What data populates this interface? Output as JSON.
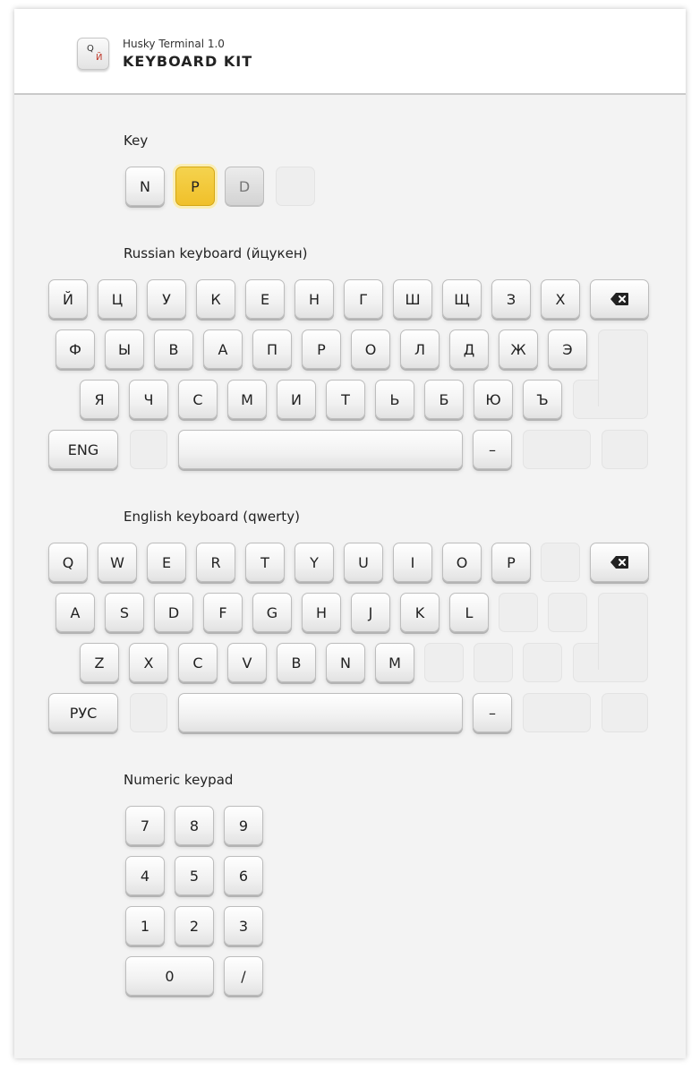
{
  "header": {
    "app_subtitle": "Husky Terminal 1.0",
    "app_title": "KEYBOARD KIT",
    "logo_top_glyph": "Q",
    "logo_bottom_glyph": "Й"
  },
  "sections": {
    "key_states": "Key",
    "russian": "Russian keyboard (йцукен)",
    "english": "English keyboard (qwerty)",
    "numeric": "Numeric keypad"
  },
  "key_states": {
    "normal": "N",
    "pressed": "P",
    "disabled": "D"
  },
  "russian": {
    "row1": [
      "Й",
      "Ц",
      "У",
      "К",
      "Е",
      "Н",
      "Г",
      "Ш",
      "Щ",
      "З",
      "Х"
    ],
    "row2": [
      "Ф",
      "Ы",
      "В",
      "А",
      "П",
      "Р",
      "О",
      "Л",
      "Д",
      "Ж",
      "Э"
    ],
    "row3": [
      "Я",
      "Ч",
      "С",
      "М",
      "И",
      "Т",
      "Ь",
      "Б",
      "Ю",
      "Ъ"
    ],
    "lang_switch": "ENG",
    "dash": "–"
  },
  "english": {
    "row1": [
      "Q",
      "W",
      "E",
      "R",
      "T",
      "Y",
      "U",
      "I",
      "O",
      "P"
    ],
    "row2": [
      "A",
      "S",
      "D",
      "F",
      "G",
      "H",
      "J",
      "K",
      "L"
    ],
    "row3": [
      "Z",
      "X",
      "C",
      "V",
      "B",
      "N",
      "M"
    ],
    "lang_switch": "РУС",
    "dash": "–"
  },
  "numeric": {
    "row1": [
      "7",
      "8",
      "9"
    ],
    "row2": [
      "4",
      "5",
      "6"
    ],
    "row3": [
      "1",
      "2",
      "3"
    ],
    "zero": "0",
    "slash": "/"
  },
  "colors": {
    "accent_pressed": "#f0c02a",
    "background": "#f3f3f3"
  },
  "icons": {
    "backspace": "backspace-icon"
  }
}
